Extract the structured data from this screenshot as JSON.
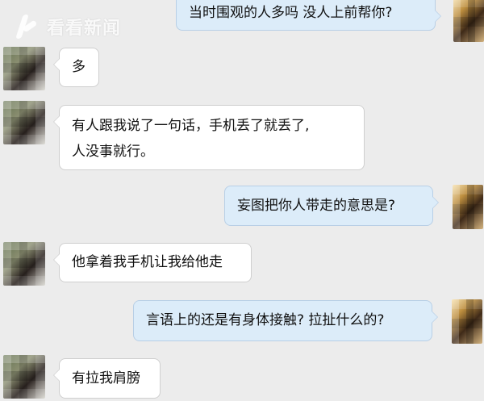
{
  "watermark": {
    "text": "看看新闻"
  },
  "messages": [
    {
      "side": "right",
      "text": "当时围观的人多吗 没人上前帮你?"
    },
    {
      "side": "left",
      "text": "多"
    },
    {
      "side": "left",
      "line1": "有人跟我说了一句话，手机丢了就丢了,",
      "line2": "人没事就行。"
    },
    {
      "side": "right",
      "text": "妄图把你人带走的意思是?"
    },
    {
      "side": "left",
      "text": "他拿着我手机让我给他走"
    },
    {
      "side": "right",
      "text": "言语上的还是有身体接触? 拉扯什么的?"
    },
    {
      "side": "left",
      "text": "有拉我肩膀"
    }
  ]
}
